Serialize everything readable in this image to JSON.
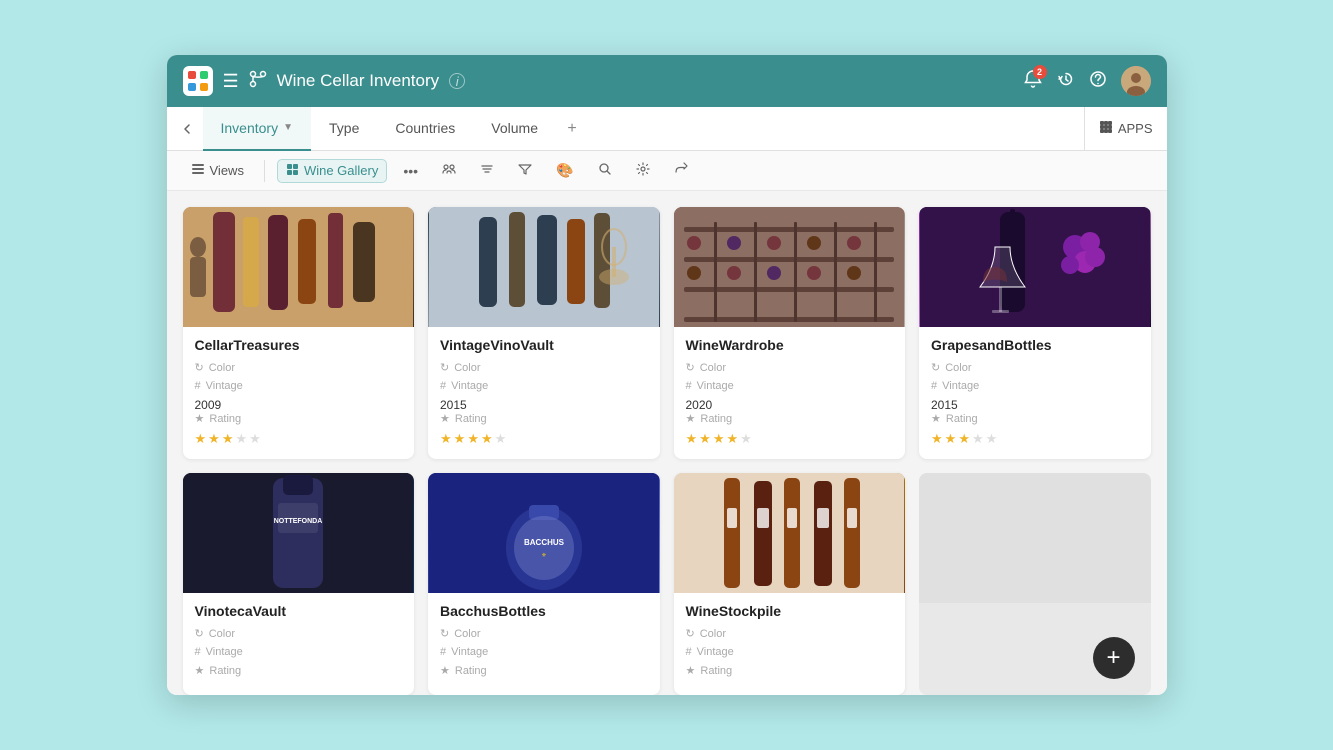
{
  "header": {
    "logo_emoji": "🎨",
    "title": "Wine Cellar Inventory",
    "info_label": "i",
    "hamburger_label": "☰",
    "branch_icon": "⑂",
    "notification_count": "2",
    "apps_label": "APPS"
  },
  "tabs": {
    "collapse_icon": "❮",
    "items": [
      {
        "id": "inventory",
        "label": "Inventory",
        "active": true,
        "dropdown": true
      },
      {
        "id": "type",
        "label": "Type",
        "active": false,
        "dropdown": false
      },
      {
        "id": "countries",
        "label": "Countries",
        "active": false,
        "dropdown": false
      },
      {
        "id": "volume",
        "label": "Volume",
        "active": false,
        "dropdown": false
      }
    ],
    "add_icon": "+"
  },
  "toolbar": {
    "views_label": "Views",
    "view_chip_label": "Wine Gallery",
    "icons": [
      "👥",
      "⇅",
      "▽",
      "🎨",
      "🔍",
      "⚙",
      "↗"
    ]
  },
  "gallery": {
    "cards": [
      {
        "id": "cellartreasures",
        "title": "CellarTreasures",
        "color_label": "Color",
        "vintage_label": "Vintage",
        "vintage_value": "2009",
        "rating_label": "Rating",
        "rating_filled": 3,
        "rating_empty": 2,
        "img_class": "img-cellartreasures"
      },
      {
        "id": "vintagevinovault",
        "title": "VintageVinoVault",
        "color_label": "Color",
        "vintage_label": "Vintage",
        "vintage_value": "2015",
        "rating_label": "Rating",
        "rating_filled": 4,
        "rating_empty": 1,
        "img_class": "img-vintagevinovault"
      },
      {
        "id": "winewardrobe",
        "title": "WineWardrobe",
        "color_label": "Color",
        "vintage_label": "Vintage",
        "vintage_value": "2020",
        "rating_label": "Rating",
        "rating_filled": 4,
        "rating_empty": 1,
        "img_class": "img-winewardrobe"
      },
      {
        "id": "grapesandbottles",
        "title": "GrapesandBottles",
        "color_label": "Color",
        "vintage_label": "Vintage",
        "vintage_value": "2015",
        "rating_label": "Rating",
        "rating_filled": 3,
        "rating_empty": 2,
        "img_class": "img-grapesandbottles"
      },
      {
        "id": "vinotecavault",
        "title": "VinotecaVault",
        "color_label": "Color",
        "vintage_label": "Vintage",
        "vintage_value": "",
        "rating_label": "Rating",
        "rating_filled": 0,
        "rating_empty": 0,
        "img_class": "img-vinotecavault"
      },
      {
        "id": "bacchusbottles",
        "title": "BacchusBottles",
        "color_label": "Color",
        "vintage_label": "Vintage",
        "vintage_value": "",
        "rating_label": "Rating",
        "rating_filled": 0,
        "rating_empty": 0,
        "img_class": "img-bacchusbottles"
      },
      {
        "id": "winestockpile",
        "title": "WineStockpile",
        "color_label": "Color",
        "vintage_label": "Vintage",
        "vintage_value": "",
        "rating_label": "Rating",
        "rating_filled": 0,
        "rating_empty": 0,
        "img_class": "img-winestockpile"
      }
    ],
    "add_label": "+"
  },
  "colors": {
    "header_bg": "#3a8e8e",
    "active_tab": "#3a8e8e",
    "star_filled": "#f0b429",
    "star_empty": "#ddd"
  }
}
